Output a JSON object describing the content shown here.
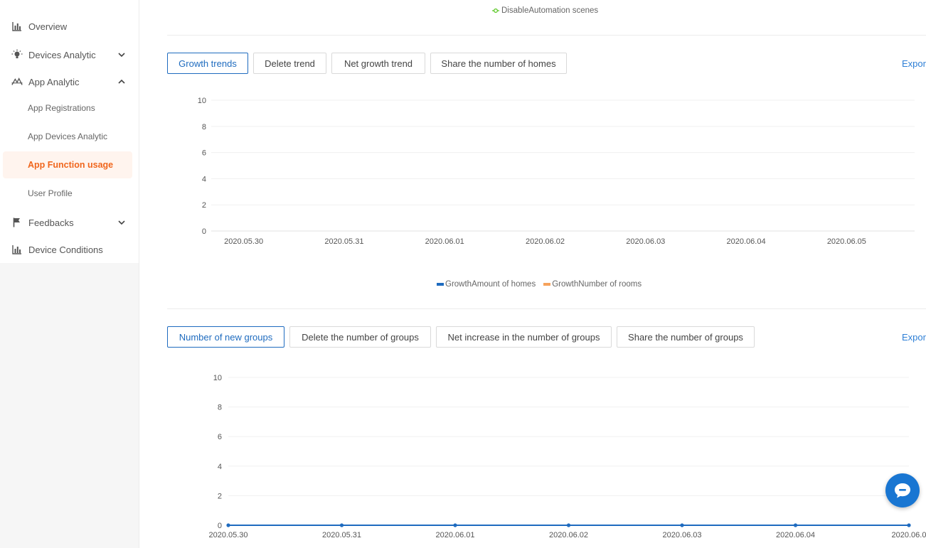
{
  "sidebar": {
    "items": [
      {
        "label": "Overview",
        "icon": "bar-chart-icon"
      },
      {
        "label": "Devices Analytic",
        "icon": "lightbulb-icon",
        "expanded": false
      },
      {
        "label": "App Analytic",
        "icon": "app-analytic-icon",
        "expanded": true
      },
      {
        "label": "Feedbacks",
        "icon": "flag-icon",
        "expanded": false
      },
      {
        "label": "Device Conditions",
        "icon": "bar-chart-icon"
      }
    ],
    "sub_items": [
      {
        "label": "App Registrations"
      },
      {
        "label": "App Devices Analytic"
      },
      {
        "label": "App Function usage",
        "active": true
      },
      {
        "label": "User Profile"
      }
    ]
  },
  "top_legend": {
    "label": "DisableAutomation scenes",
    "color": "#52c41a"
  },
  "homes_section": {
    "tabs": [
      "Growth trends",
      "Delete trend",
      "Net growth trend",
      "Share the number of homes"
    ],
    "active_tab": 0,
    "export_label": "Expor"
  },
  "groups_section": {
    "tabs": [
      "Number of new groups",
      "Delete the number of groups",
      "Net increase in the number of groups",
      "Share the number of groups"
    ],
    "active_tab": 0,
    "export_label": "Expor"
  },
  "chart_data": [
    {
      "type": "bar",
      "categories": [
        "2020.05.30",
        "2020.05.31",
        "2020.06.01",
        "2020.06.02",
        "2020.06.03",
        "2020.06.04",
        "2020.06.05"
      ],
      "series": [
        {
          "name": "GrowthAmount of homes",
          "color": "#1e6bbf",
          "values": [
            0,
            0,
            0,
            0,
            0,
            0,
            0
          ]
        },
        {
          "name": "GrowthNumber of rooms",
          "color": "#f6a25c",
          "values": [
            0,
            0,
            0,
            0,
            0,
            0,
            0
          ]
        }
      ],
      "yticks": [
        0,
        2,
        4,
        6,
        8,
        10
      ],
      "ylim": [
        0,
        10
      ],
      "grid": true,
      "legend": "bottom-center"
    },
    {
      "type": "line",
      "categories": [
        "2020.05.30",
        "2020.05.31",
        "2020.06.01",
        "2020.06.02",
        "2020.06.03",
        "2020.06.04",
        "2020.06.0"
      ],
      "series": [
        {
          "color": "#1e6bbf",
          "values": [
            0,
            0,
            0,
            0,
            0,
            0,
            0
          ]
        }
      ],
      "yticks": [
        0,
        2,
        4,
        6,
        8,
        10
      ],
      "ylim": [
        0,
        10
      ],
      "grid": true
    }
  ],
  "chat": {
    "icon": "chat-bubble-icon",
    "color": "#1976d2"
  }
}
